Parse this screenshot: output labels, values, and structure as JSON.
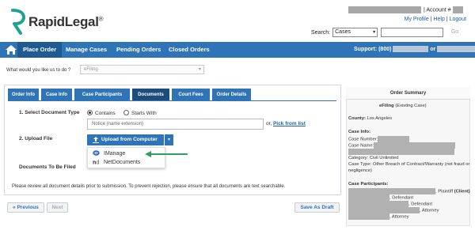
{
  "brand": {
    "name": "RapidLegal",
    "trademark": "®"
  },
  "header": {
    "account_label": "| Account #",
    "links": [
      "My Profile",
      "Help",
      "Logout"
    ],
    "search_label": "Search:",
    "search_select": "Cases",
    "go_label": "Go"
  },
  "nav": {
    "items": [
      "Place Order",
      "Manage Cases",
      "Pending Orders",
      "Closed Orders"
    ],
    "support_label": "Support: (800)",
    "support_or": "or"
  },
  "question": {
    "label": "What would you like us to do ?",
    "selected": "eFiling"
  },
  "tabs": [
    "Order Info",
    "Case Info",
    "Case Participants",
    "Documents",
    "Court Fees",
    "Order Details"
  ],
  "documents": {
    "step1_label": "1. Select Document Type",
    "radio_contains": "Contains",
    "radio_starts": "Starts With",
    "notice_value": "Notice (name extension)",
    "or_label": "or,",
    "pick_from_list": "Pick from list",
    "step2_label": "2. Upload File",
    "upload_button": "Upload from Computer",
    "dropdown_items": [
      "IManage",
      "NetDocuments"
    ],
    "documents_to_be_filed": "Documents To Be Filed",
    "review_note": "Please review all document details prior to submission. To prevent rejection, please ensure that all documents are text searchable."
  },
  "buttons": {
    "previous": "« Previous",
    "next": "Next",
    "save_draft": "Save As Draft"
  },
  "summary": {
    "title": "Order Summary",
    "efiling_bold": "eFiling",
    "efiling_rest": "(Existing Case)",
    "county_label": "County:",
    "county_value": "Los Angeles",
    "case_info_label": "Case Info:",
    "case_number_label": "Case Number:",
    "case_name_label": "Case Name:",
    "category": "Category: Civil Unlimited",
    "case_type": "Case Type: Other Breach of Contract/Warranty (not fraud or",
    "case_type_cont": "negligence)",
    "participants_label": "Case Participants:",
    "participants": [
      ", Plaintiff",
      ", Defendant",
      ", Defendant",
      ", Attorney",
      ", Attorney"
    ],
    "plaintiff_client": "(Client)"
  },
  "colors": {
    "primary": "#2f74b6",
    "primary_dark": "#1d4d7c",
    "logo_teal": "#1fa38f",
    "arrow_green": "#2e9e62"
  }
}
